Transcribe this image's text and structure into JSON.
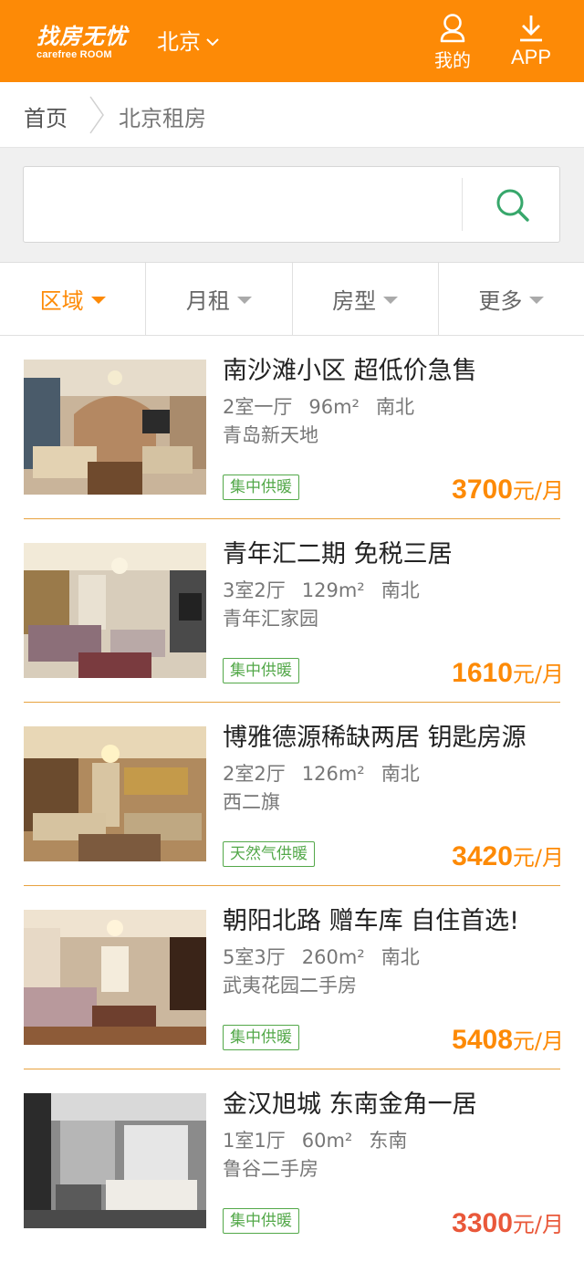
{
  "header": {
    "logo_cn": "找房无忧",
    "logo_en": "carefree ROOM",
    "city": "北京",
    "me_label": "我的",
    "app_label": "APP",
    "color": "#fd8a06"
  },
  "breadcrumb": {
    "home": "首页",
    "current": "北京租房"
  },
  "search": {
    "placeholder": "",
    "icon": "search-icon"
  },
  "filters": [
    {
      "label": "区域",
      "active": true
    },
    {
      "label": "月租",
      "active": false
    },
    {
      "label": "房型",
      "active": false
    },
    {
      "label": "更多",
      "active": false
    }
  ],
  "listings": [
    {
      "title": "南沙滩小区 超低价急售",
      "layout": "2室一厅",
      "area": "96m²",
      "orientation": "南北",
      "community": "青岛新天地",
      "tag": "集中供暖",
      "price": "3700",
      "unit": "元/月"
    },
    {
      "title": "青年汇二期 免税三居",
      "layout": "3室2厅",
      "area": "129m²",
      "orientation": "南北",
      "community": "青年汇家园",
      "tag": "集中供暖",
      "price": "1610",
      "unit": "元/月"
    },
    {
      "title": "博雅德源稀缺两居 钥匙房源",
      "layout": "2室2厅",
      "area": "126m²",
      "orientation": "南北",
      "community": "西二旗",
      "tag": "天然气供暖",
      "price": "3420",
      "unit": "元/月"
    },
    {
      "title": "朝阳北路 赠车库 自住首选!",
      "layout": "5室3厅",
      "area": "260m²",
      "orientation": "南北",
      "community": "武夷花园二手房",
      "tag": "集中供暖",
      "price": "5408",
      "unit": "元/月"
    },
    {
      "title": "金汉旭城 东南金角一居",
      "layout": "1室1厅",
      "area": "60m²",
      "orientation": "东南",
      "community": "鲁谷二手房",
      "tag": "集中供暖",
      "price": "3300",
      "unit": "元/月"
    }
  ]
}
